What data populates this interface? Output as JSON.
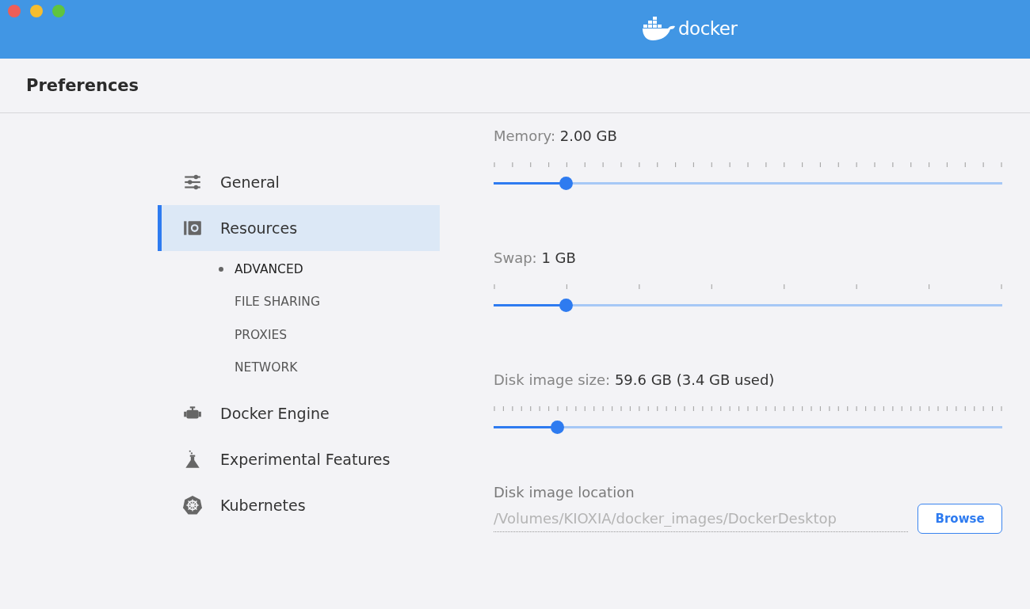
{
  "window": {
    "logo_text": "docker"
  },
  "header": {
    "title": "Preferences"
  },
  "sidebar": {
    "items": [
      {
        "label": "General",
        "selected": false
      },
      {
        "label": "Resources",
        "selected": true,
        "children": [
          {
            "label": "ADVANCED",
            "selected": true
          },
          {
            "label": "FILE SHARING",
            "selected": false
          },
          {
            "label": "PROXIES",
            "selected": false
          },
          {
            "label": "NETWORK",
            "selected": false
          }
        ]
      },
      {
        "label": "Docker Engine",
        "selected": false
      },
      {
        "label": "Experimental Features",
        "selected": false
      },
      {
        "label": "Kubernetes",
        "selected": false
      }
    ]
  },
  "settings": {
    "sliders": [
      {
        "label": "Memory:",
        "value": "2.00 GB",
        "level": 0.142
      },
      {
        "label": "Swap:",
        "value": "1 GB",
        "level": 0.142
      },
      {
        "label": "Disk image size:",
        "value": "59.6 GB (3.4 GB used)",
        "level": 0.125
      }
    ],
    "location": {
      "label": "Disk image location",
      "value": "/Volumes/KIOXIA/docker_images/DockerDesktop",
      "disabled": true,
      "button": "Browse"
    }
  }
}
